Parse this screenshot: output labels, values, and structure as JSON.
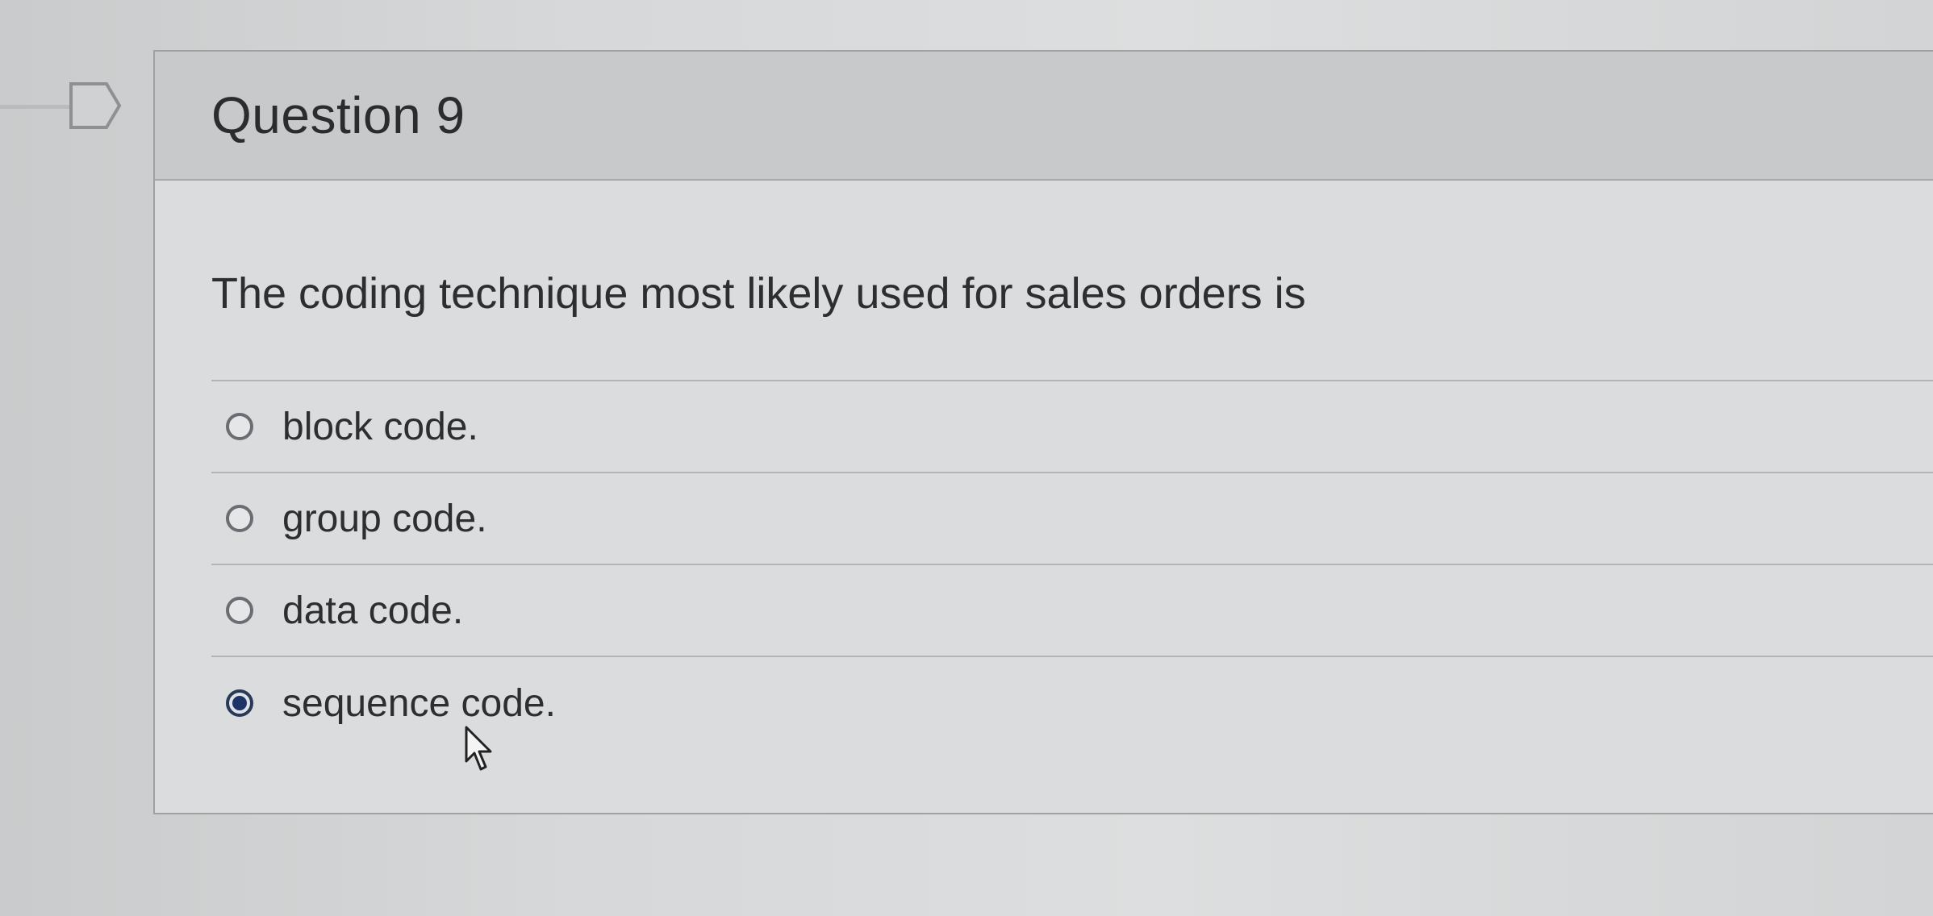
{
  "question": {
    "title": "Question 9",
    "prompt": "The coding technique most likely used for sales orders is",
    "answers": [
      {
        "label": "block code.",
        "selected": false
      },
      {
        "label": "group code.",
        "selected": false
      },
      {
        "label": "data code.",
        "selected": false
      },
      {
        "label": "sequence code.",
        "selected": true
      }
    ]
  },
  "icons": {
    "flag": "flag-icon",
    "cursor": "pointer-cursor-icon"
  },
  "colors": {
    "selected_radio": "#1d3566",
    "header_bg": "#c7c9ca"
  }
}
